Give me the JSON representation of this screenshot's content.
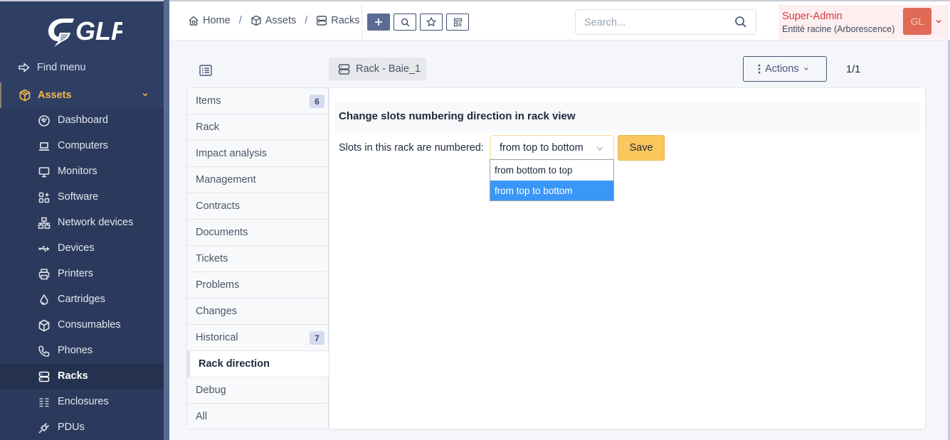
{
  "app": {
    "logo_text": "GLPI",
    "colors": {
      "sidebar_bg": "#2f3f64",
      "accent": "#f2b84b",
      "select_highlight": "#3b97f7",
      "save_button": "#fbc75c",
      "user_name": "#d63939",
      "avatar_bg": "#e06a55"
    }
  },
  "sidebar": {
    "find_menu": {
      "label": "Find menu",
      "icon": "arrow-right-icon"
    },
    "section": {
      "label": "Assets",
      "icon": "box-icon",
      "expanded": true
    },
    "items": [
      {
        "label": "Dashboard",
        "icon": "gauge-icon",
        "active": false
      },
      {
        "label": "Computers",
        "icon": "laptop-icon",
        "active": false
      },
      {
        "label": "Monitors",
        "icon": "monitor-icon",
        "active": false
      },
      {
        "label": "Software",
        "icon": "apps-icon",
        "active": false
      },
      {
        "label": "Network devices",
        "icon": "network-icon",
        "active": false
      },
      {
        "label": "Devices",
        "icon": "usb-icon",
        "active": false
      },
      {
        "label": "Printers",
        "icon": "printer-icon",
        "active": false
      },
      {
        "label": "Cartridges",
        "icon": "droplet-icon",
        "active": false
      },
      {
        "label": "Consumables",
        "icon": "package-icon",
        "active": false
      },
      {
        "label": "Phones",
        "icon": "phone-icon",
        "active": false
      },
      {
        "label": "Racks",
        "icon": "server-icon",
        "active": true
      },
      {
        "label": "Enclosures",
        "icon": "list-columns-icon",
        "active": false
      },
      {
        "label": "PDUs",
        "icon": "plug-icon",
        "active": false
      }
    ]
  },
  "header": {
    "breadcrumb": [
      {
        "label": "Home",
        "icon": "home-icon"
      },
      {
        "label": "Assets",
        "icon": "box-icon"
      },
      {
        "label": "Racks",
        "icon": "server-icon"
      }
    ],
    "separator": "/",
    "toolbar": [
      {
        "name": "add",
        "icon": "plus-icon"
      },
      {
        "name": "search",
        "icon": "search-icon"
      },
      {
        "name": "saved-searches",
        "icon": "star-icon"
      },
      {
        "name": "templates",
        "icon": "template-icon"
      }
    ],
    "search": {
      "placeholder": "Search...",
      "value": ""
    },
    "user": {
      "profile": "Super-Admin",
      "entity": "Entité racine (Arborescence)",
      "initials": "GL"
    }
  },
  "page": {
    "item_title": "Rack - Baie_1",
    "actions_label": "Actions",
    "pager": "1/1"
  },
  "tabs": [
    {
      "label": "Items",
      "badge": "6",
      "active": false
    },
    {
      "label": "Rack",
      "badge": null,
      "active": false
    },
    {
      "label": "Impact analysis",
      "badge": null,
      "active": false
    },
    {
      "label": "Management",
      "badge": null,
      "active": false
    },
    {
      "label": "Contracts",
      "badge": null,
      "active": false
    },
    {
      "label": "Documents",
      "badge": null,
      "active": false
    },
    {
      "label": "Tickets",
      "badge": null,
      "active": false
    },
    {
      "label": "Problems",
      "badge": null,
      "active": false
    },
    {
      "label": "Changes",
      "badge": null,
      "active": false
    },
    {
      "label": "Historical",
      "badge": "7",
      "active": false
    },
    {
      "label": "Rack direction",
      "badge": null,
      "active": true
    },
    {
      "label": "Debug",
      "badge": null,
      "active": false
    },
    {
      "label": "All",
      "badge": null,
      "active": false
    }
  ],
  "form": {
    "section_title": "Change slots numbering direction in rack view",
    "field_label": "Slots in this rack are numbered:",
    "select_value": "from top to bottom",
    "options": [
      {
        "label": "from bottom to top",
        "selected": false
      },
      {
        "label": "from top to bottom",
        "selected": true
      }
    ],
    "save_label": "Save"
  }
}
